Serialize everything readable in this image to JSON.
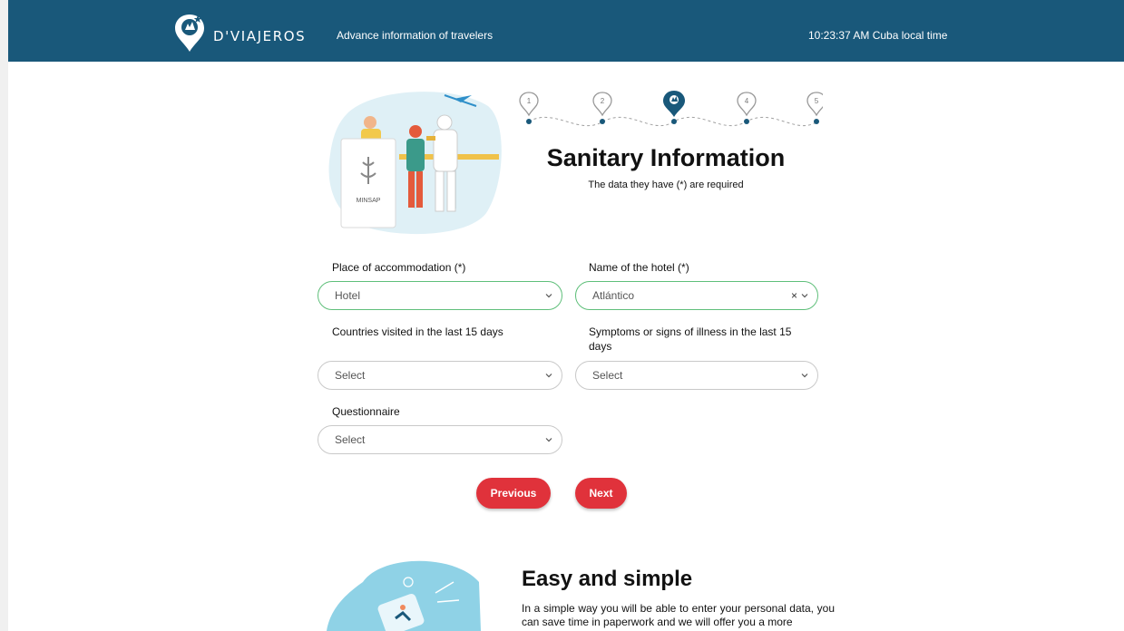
{
  "header": {
    "brand": "D'VIAJEROS",
    "tagline": "Advance information of travelers",
    "clock": "10:23:37 AM Cuba local time",
    "background_color": "#19587a"
  },
  "hero": {
    "illustration_sign_text": "MINSAP"
  },
  "steps": {
    "items": [
      "1",
      "2",
      "3",
      "4",
      "5"
    ],
    "current": 3
  },
  "form": {
    "title": "Sanitary Information",
    "subtitle": "The data they have (*) are required",
    "accommodation": {
      "label": "Place of accommodation (*)",
      "value": "Hotel"
    },
    "hotel": {
      "label": "Name of the hotel (*)",
      "value": "Atlántico",
      "clear": "×"
    },
    "countries": {
      "label": "Countries visited in the last 15 days",
      "value": "Select"
    },
    "symptoms": {
      "label": "Symptoms or signs of illness in the last 15 days",
      "value": "Select"
    },
    "questionnaire": {
      "label": "Questionnaire",
      "value": "Select"
    },
    "previous_label": "Previous",
    "next_label": "Next",
    "button_color": "#e0323b",
    "active_border_color": "#5fbf7a"
  },
  "promo": {
    "title": "Easy and simple",
    "text": "In a simple way you will be able to enter your personal data, you can save time in paperwork and we will offer you a more"
  }
}
